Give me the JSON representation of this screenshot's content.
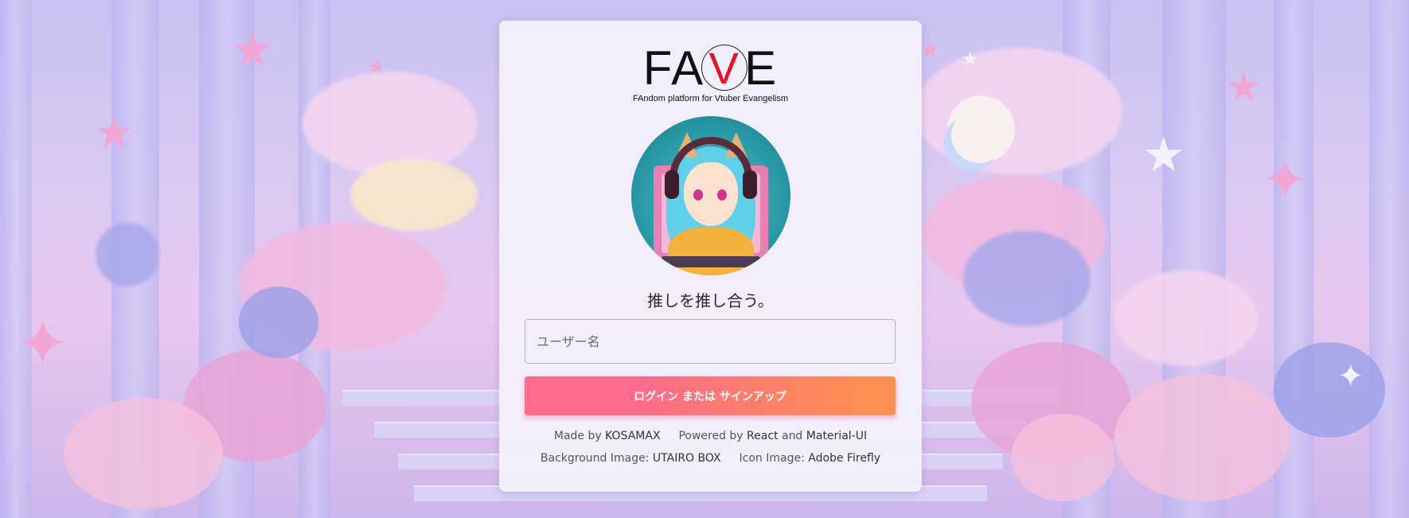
{
  "logo": {
    "text_left": "FA",
    "text_v": "V",
    "text_right": "E",
    "subtitle": "FAndom platform for Vtuber Evangelism"
  },
  "tagline": "推しを推し合う。",
  "login_form": {
    "username_placeholder": "ユーザー名",
    "username_value": "",
    "submit_label": "ログイン または サインアップ"
  },
  "credits": {
    "made_by_prefix": "Made by",
    "made_by_name": "KOSAMAX",
    "powered_by_prefix": "Powered by",
    "powered_by_1": "React",
    "powered_by_and": "and",
    "powered_by_2": "Material-UI",
    "bg_image_prefix": "Background Image:",
    "bg_image_name": "UTAIRO BOX",
    "icon_image_prefix": "Icon Image:",
    "icon_image_name": "Adobe Firefly"
  },
  "colors": {
    "button_gradient_start": "#fe6b8b",
    "button_gradient_end": "#ff8e53",
    "logo_accent": "#e4132a"
  },
  "icons": {
    "avatar": "anime-vtuber-avatar-icon"
  }
}
